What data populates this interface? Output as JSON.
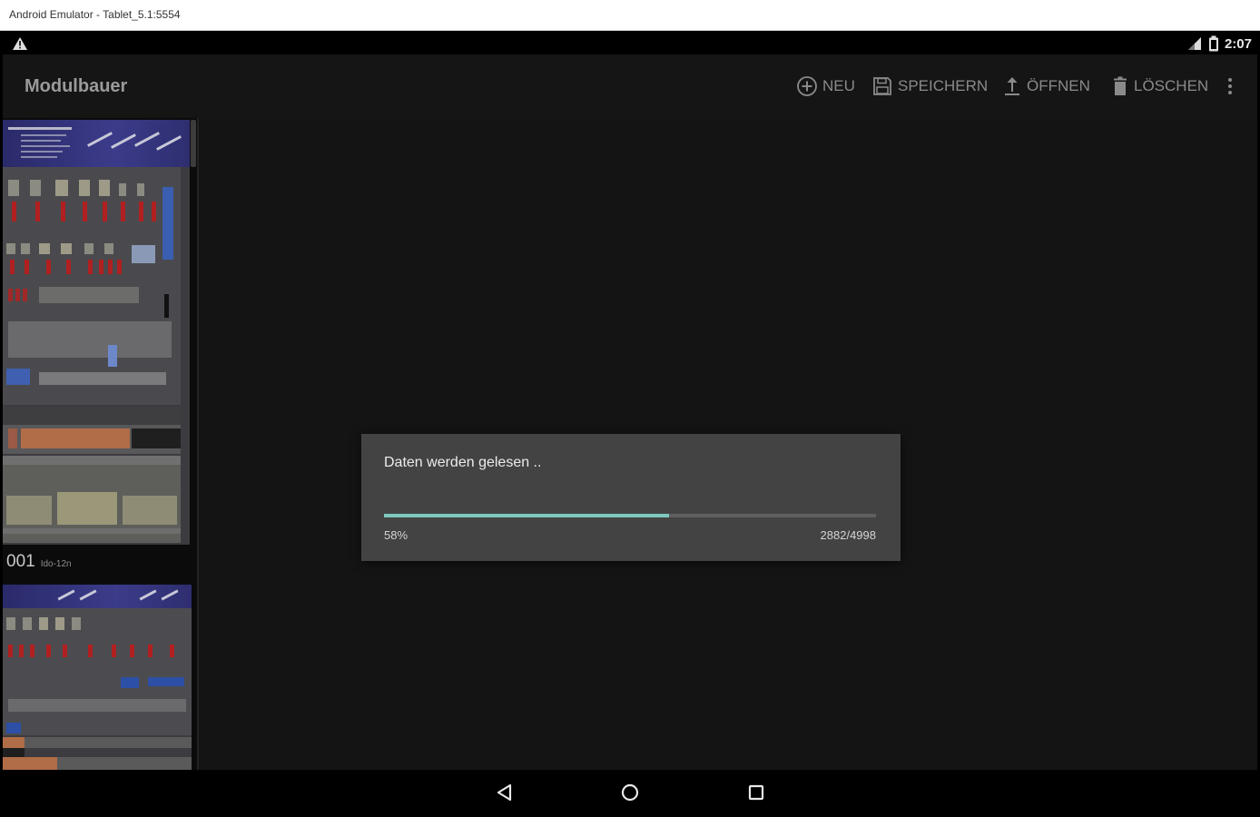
{
  "window": {
    "title": "Android Emulator - Tablet_5.1:5554"
  },
  "status_bar": {
    "time": "2:07",
    "icons": [
      "warning-icon",
      "signal-icon",
      "battery-icon"
    ]
  },
  "action_bar": {
    "title": "Modulbauer",
    "actions": [
      {
        "label": "NEU",
        "icon": "add-circle-icon"
      },
      {
        "label": "SPEICHERN",
        "icon": "floppy-disk-icon"
      },
      {
        "label": "ÖFFNEN",
        "icon": "upload-icon"
      },
      {
        "label": "LÖSCHEN",
        "icon": "trash-icon"
      }
    ],
    "overflow_icon": "more-vert-icon"
  },
  "sidebar": {
    "items": [
      {
        "label_number": "001",
        "label_small": "Ido-12n"
      }
    ]
  },
  "dialog": {
    "message": "Daten werden gelesen ..",
    "progress_fraction": 0.58,
    "percent_text": "58%",
    "count_text": "2882/4998",
    "progress_color": "#7ec8c0"
  },
  "nav_bar": {
    "buttons": [
      "back-icon",
      "home-icon",
      "recents-icon"
    ]
  }
}
